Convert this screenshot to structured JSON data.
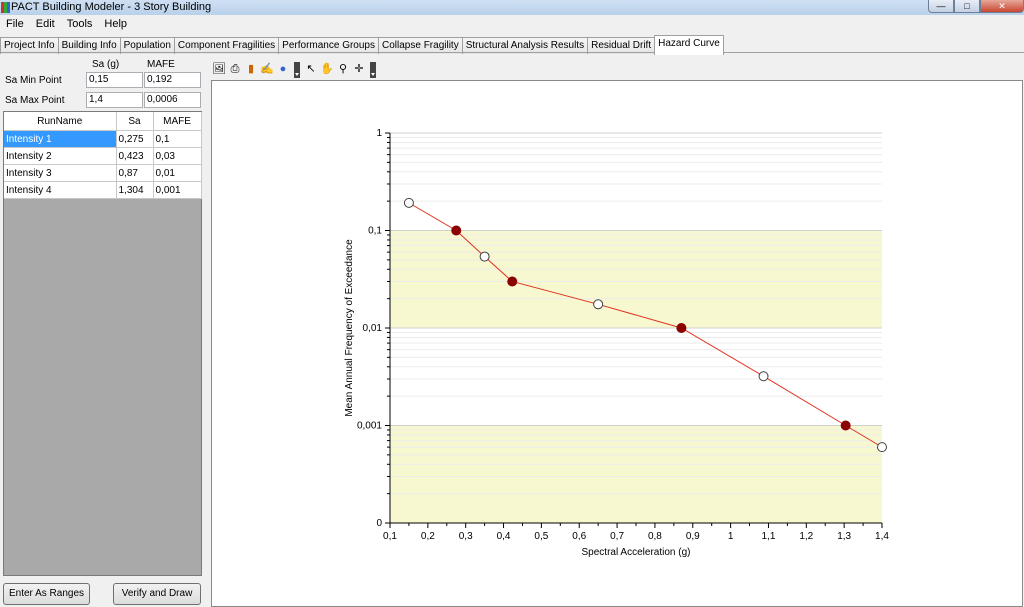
{
  "window": {
    "title": "PACT Building Modeler - 3 Story Building"
  },
  "menu": [
    "File",
    "Edit",
    "Tools",
    "Help"
  ],
  "tabs": [
    {
      "label": "Project Info"
    },
    {
      "label": "Building Info"
    },
    {
      "label": "Population"
    },
    {
      "label": "Component Fragilities"
    },
    {
      "label": "Performance Groups"
    },
    {
      "label": "Collapse Fragility"
    },
    {
      "label": "Structural Analysis Results"
    },
    {
      "label": "Residual Drift"
    },
    {
      "label": "Hazard Curve",
      "active": true
    }
  ],
  "hazard_inputs": {
    "col_sa": "Sa (g)",
    "col_mafe": "MAFE",
    "min_label": "Sa Min Point",
    "max_label": "Sa Max Point",
    "min_sa": "0,15",
    "min_mafe": "0,192",
    "max_sa": "1,4",
    "max_mafe": "0,0006"
  },
  "intensity_table": {
    "headers": [
      "RunName",
      "Sa",
      "MAFE"
    ],
    "rows": [
      [
        "Intensity 1",
        "0,275",
        "0,1"
      ],
      [
        "Intensity 2",
        "0,423",
        "0,03"
      ],
      [
        "Intensity 3",
        "0,87",
        "0,01"
      ],
      [
        "Intensity 4",
        "1,304",
        "0,001"
      ]
    ]
  },
  "buttons": {
    "ranges": "Enter As Ranges",
    "verify": "Verify and Draw"
  },
  "toolbar_icons": [
    "image-icon",
    "print-icon",
    "bar-chart-icon",
    "hand-edit-icon",
    "palette-icon",
    "pointer-icon",
    "pan-hand-icon",
    "zoom-icon",
    "crosshair-icon"
  ],
  "chart_data": {
    "type": "line",
    "xlabel": "Spectral Acceleration (g)",
    "ylabel": "Mean Annual Frequency of Exceedance",
    "x_ticks": [
      "0,1",
      "0,2",
      "0,3",
      "0,4",
      "0,5",
      "0,6",
      "0,7",
      "0,8",
      "0,9",
      "1",
      "1,1",
      "1,2",
      "1,3",
      "1,4"
    ],
    "y_ticks": [
      {
        "v": 1,
        "label": "1"
      },
      {
        "v": 0.1,
        "label": "0,1"
      },
      {
        "v": 0.01,
        "label": "0,01"
      },
      {
        "v": 0.001,
        "label": "0,001"
      },
      {
        "v": 0.0001,
        "label": "0"
      }
    ],
    "xlim": [
      0.1,
      1.4
    ],
    "ylim": [
      0.0001,
      1
    ],
    "y_scale": "log",
    "grid": true,
    "colors": {
      "line": "#e03020",
      "marker_fill": "#8b0000",
      "band": "#f7f7d0"
    },
    "points": [
      {
        "x": 0.15,
        "y": 0.192,
        "filled": false
      },
      {
        "x": 0.275,
        "y": 0.1,
        "filled": true
      },
      {
        "x": 0.35,
        "y": 0.054,
        "filled": false
      },
      {
        "x": 0.423,
        "y": 0.03,
        "filled": true
      },
      {
        "x": 0.65,
        "y": 0.0175,
        "filled": false
      },
      {
        "x": 0.87,
        "y": 0.01,
        "filled": true
      },
      {
        "x": 1.087,
        "y": 0.0032,
        "filled": false
      },
      {
        "x": 1.304,
        "y": 0.001,
        "filled": true
      },
      {
        "x": 1.4,
        "y": 0.0006,
        "filled": false
      }
    ]
  }
}
